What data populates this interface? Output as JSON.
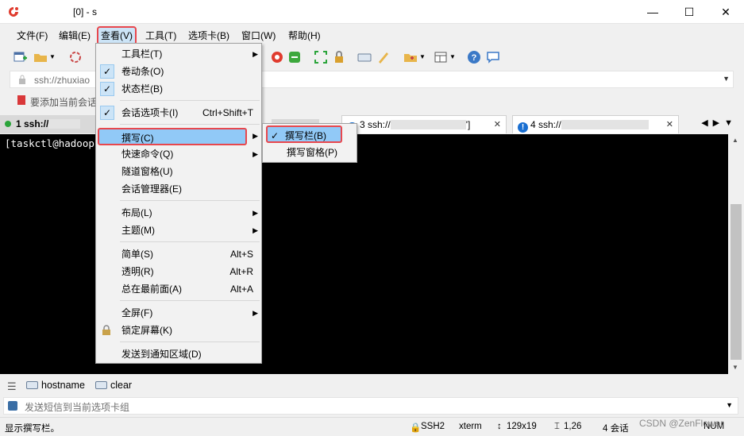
{
  "titlebar": {
    "title": "[0] - s",
    "minimize": "—",
    "maximize": "☐",
    "close": "✕"
  },
  "menubar": {
    "items": [
      "文件(F)",
      "编辑(E)",
      "查看(V)",
      "工具(T)",
      "选项卡(B)",
      "窗口(W)",
      "帮助(H)"
    ]
  },
  "addressbar": {
    "value": "ssh://zhuxiao"
  },
  "favbar": {
    "text": "要添加当前会话"
  },
  "tabs": {
    "tab1": "1 ssh://",
    "tab2_end": "\\",
    "tab3": "3 ssh://",
    "tab3_end": "']",
    "tab4": "4 ssh://"
  },
  "terminal": {
    "line": "[taskctl@hadoop-"
  },
  "view_menu": {
    "items": [
      {
        "label": "工具栏(T)",
        "shortcut": "",
        "submenu": true,
        "checked": false
      },
      {
        "label": "卷动条(O)",
        "shortcut": "",
        "submenu": false,
        "checked": true
      },
      {
        "label": "状态栏(B)",
        "shortcut": "",
        "submenu": false,
        "checked": true
      },
      {
        "label": "会话选项卡(I)",
        "shortcut": "Ctrl+Shift+T",
        "submenu": false,
        "checked": true
      },
      {
        "label": "撰写(C)",
        "shortcut": "",
        "submenu": true,
        "checked": false
      },
      {
        "label": "快速命令(Q)",
        "shortcut": "",
        "submenu": true,
        "checked": false
      },
      {
        "label": "隧道窗格(U)",
        "shortcut": "",
        "submenu": false,
        "checked": false
      },
      {
        "label": "会话管理器(E)",
        "shortcut": "",
        "submenu": false,
        "checked": false
      },
      {
        "label": "布局(L)",
        "shortcut": "",
        "submenu": true,
        "checked": false
      },
      {
        "label": "主题(M)",
        "shortcut": "",
        "submenu": true,
        "checked": false
      },
      {
        "label": "简单(S)",
        "shortcut": "Alt+S",
        "submenu": false,
        "checked": false
      },
      {
        "label": "透明(R)",
        "shortcut": "Alt+R",
        "submenu": false,
        "checked": false
      },
      {
        "label": "总在最前面(A)",
        "shortcut": "Alt+A",
        "submenu": false,
        "checked": false
      },
      {
        "label": "全屏(F)",
        "shortcut": "",
        "submenu": true,
        "checked": false
      },
      {
        "label": "锁定屏幕(K)",
        "shortcut": "",
        "submenu": false,
        "checked": false
      },
      {
        "label": "发送到通知区域(D)",
        "shortcut": "",
        "submenu": false,
        "checked": false
      }
    ]
  },
  "compose_submenu": {
    "items": [
      {
        "label": "撰写栏(B)",
        "checked": true
      },
      {
        "label": "撰写窗格(P)",
        "checked": false
      }
    ]
  },
  "buttonbar": {
    "buttons": [
      "hostname",
      "clear"
    ]
  },
  "command_window": {
    "placeholder": "发送短信到当前选项卡组"
  },
  "statusbar": {
    "message": "显示撰写栏。",
    "protocol": "SSH2",
    "term": "xterm",
    "size": "129x19",
    "cursor": "1,26",
    "sessions": "4 会话",
    "num": "NUM"
  },
  "watermark": "CSDN @ZenFlower",
  "colors": {
    "highlight_border": "#e8474d",
    "menu_highlight": "#91c9f7",
    "terminal_bg": "#000000"
  }
}
